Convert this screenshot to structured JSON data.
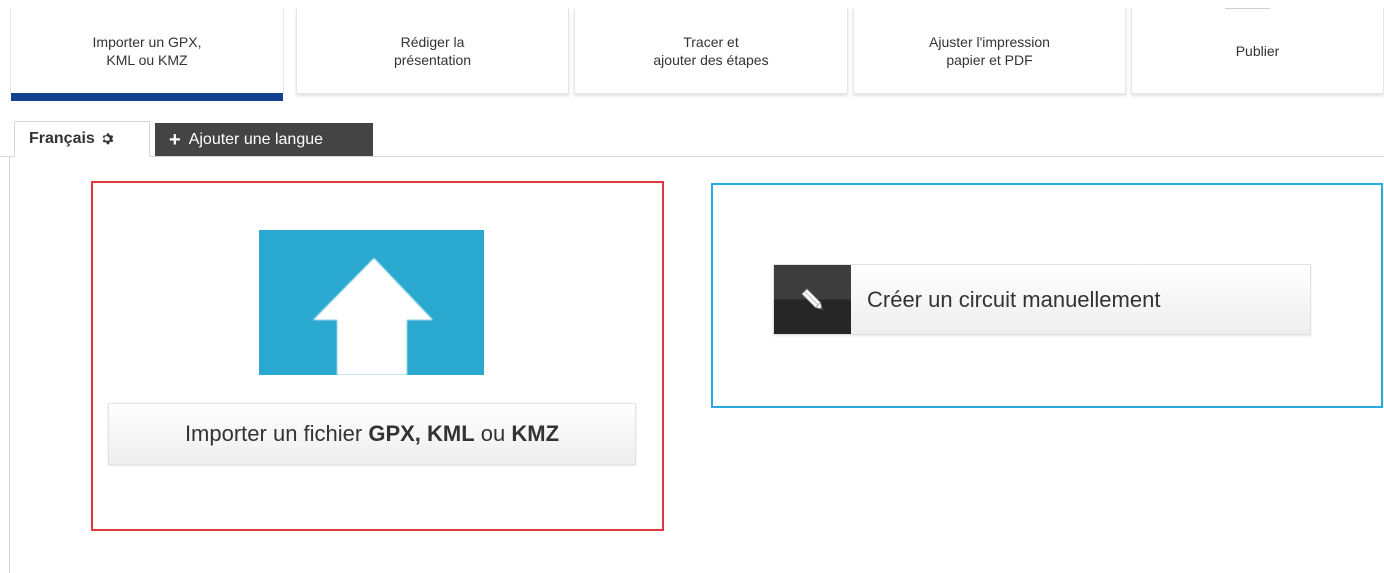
{
  "steps": [
    {
      "label": "Importer un GPX,\nKML ou KMZ",
      "active": true
    },
    {
      "label": "Rédiger la\nprésentation",
      "active": false
    },
    {
      "label": "Tracer et\najouter des étapes",
      "active": false
    },
    {
      "label": "Ajuster l'impression\npapier et PDF",
      "active": false
    },
    {
      "label": "Publier",
      "active": false
    }
  ],
  "language_tabs": {
    "current": "Français",
    "current_icon": "gear-icon",
    "add_icon": "plus-icon",
    "add_label": "Ajouter une langue"
  },
  "import": {
    "icon": "upload-arrow-icon",
    "button_prefix": "Importer un fichier ",
    "button_formats": "GPX, KML",
    "button_or": " ou ",
    "button_last": "KMZ"
  },
  "manual": {
    "icon": "pencil-icon",
    "button_label": "Créer un circuit manuellement"
  },
  "colors": {
    "active_step_bar": "#13418f",
    "import_border": "#e0393a",
    "manual_border": "#29a9e1",
    "upload_icon_bg": "#29a9cf",
    "add_language_bg": "#444444"
  }
}
